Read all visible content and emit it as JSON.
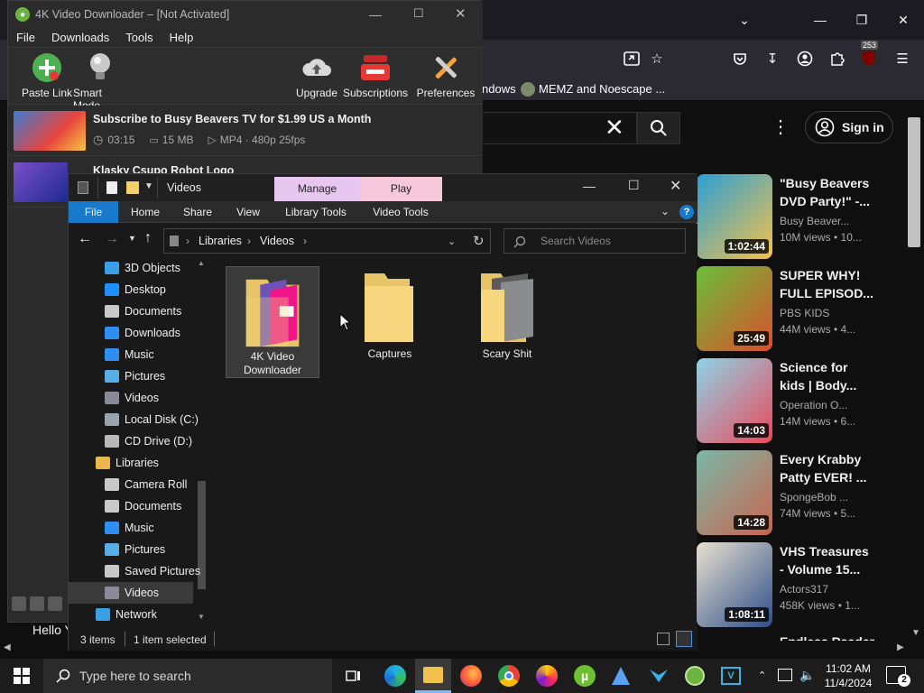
{
  "browser": {
    "bookmark_fragment": "ndows",
    "bookmark_memz": "MEMZ and Noescape ...",
    "notification_badge": "253",
    "sign_in_label": "Sign in",
    "partial_bottom_left": "Hello Y",
    "partial_bottom_title": "Endless Raader",
    "videos": [
      {
        "title_line1": "\"Busy Beavers",
        "title_line2": "DVD Party!\" -...",
        "channel": "Busy Beaver...",
        "views": "10M views  •  10...",
        "duration": "1:02:44",
        "colors": [
          "#2a9fd6",
          "#f5c24a"
        ]
      },
      {
        "title_line1": "SUPER WHY!",
        "title_line2": "FULL EPISOD...",
        "channel": "PBS KIDS",
        "views": "44M views  •  4...",
        "duration": "25:49",
        "colors": [
          "#6bbf3b",
          "#d94f2b"
        ]
      },
      {
        "title_line1": "Science for",
        "title_line2": "kids | Body...",
        "channel": "Operation O...",
        "views": "14M views  •  6...",
        "duration": "14:03",
        "colors": [
          "#8fd3e8",
          "#e84b5a"
        ]
      },
      {
        "title_line1": "Every Krabby",
        "title_line2": "Patty EVER! ...",
        "channel": "SpongeBob ...",
        "views": "74M views  •  5...",
        "duration": "14:28",
        "colors": [
          "#7ab8a8",
          "#c9654f"
        ]
      },
      {
        "title_line1": "VHS Treasures",
        "title_line2": "- Volume 15...",
        "channel": "Actors317",
        "views": "458K views  •  1...",
        "duration": "1:08:11",
        "colors": [
          "#e9e1cf",
          "#2d4d8a"
        ]
      }
    ]
  },
  "vdl": {
    "title": "4K Video Downloader – [Not Activated]",
    "menu": [
      "File",
      "Downloads",
      "Tools",
      "Help"
    ],
    "tools": {
      "paste_link": "Paste Link",
      "smart_mode": "Smart Mode",
      "upgrade": "Upgrade",
      "subscriptions": "Subscriptions",
      "preferences": "Preferences"
    },
    "items": [
      {
        "title": "Subscribe to Busy Beavers TV for $1.99 US a Month",
        "duration": "03:15",
        "size": "15 MB",
        "format": "MP4 · 480p 25fps"
      },
      {
        "title": "Klasky Csupo Robot Logo"
      }
    ]
  },
  "explorer": {
    "title": "Videos",
    "context_tabs": {
      "manage": "Manage",
      "play": "Play"
    },
    "ribbon_tabs": [
      "File",
      "Home",
      "Share",
      "View",
      "Library Tools",
      "Video Tools"
    ],
    "address": {
      "part1": "Libraries",
      "part2": "Videos"
    },
    "search_placeholder": "Search Videos",
    "nav": [
      {
        "label": "3D Objects",
        "color": "#3aa0e8",
        "indent": 1
      },
      {
        "label": "Desktop",
        "color": "#1e90ff",
        "indent": 1
      },
      {
        "label": "Documents",
        "color": "#c9c9c9",
        "indent": 1
      },
      {
        "label": "Downloads",
        "color": "#2f8ef0",
        "indent": 1
      },
      {
        "label": "Music",
        "color": "#2f8ef0",
        "indent": 1
      },
      {
        "label": "Pictures",
        "color": "#5aaee6",
        "indent": 1
      },
      {
        "label": "Videos",
        "color": "#8a8a9a",
        "indent": 1
      },
      {
        "label": "Local Disk (C:)",
        "color": "#9aa4ad",
        "indent": 1
      },
      {
        "label": "CD Drive (D:)",
        "color": "#b9b9b9",
        "indent": 1
      },
      {
        "label": "Libraries",
        "color": "#e8b84a",
        "indent": 0
      },
      {
        "label": "Camera Roll",
        "color": "#c8c8c8",
        "indent": 1
      },
      {
        "label": "Documents",
        "color": "#c9c9c9",
        "indent": 1
      },
      {
        "label": "Music",
        "color": "#2f8ef0",
        "indent": 1
      },
      {
        "label": "Pictures",
        "color": "#5aaee6",
        "indent": 1
      },
      {
        "label": "Saved Pictures",
        "color": "#c8c8c8",
        "indent": 1
      },
      {
        "label": "Videos",
        "color": "#8a8a9a",
        "indent": 1,
        "selected": true
      },
      {
        "label": "Network",
        "color": "#3aa0e8",
        "indent": 0
      }
    ],
    "folders": [
      {
        "line1": "4K Video",
        "line2": "Downloader",
        "selected": true
      },
      {
        "line1": "Captures",
        "line2": ""
      },
      {
        "line1": "Scary Shit",
        "line2": ""
      }
    ],
    "status": {
      "count": "3 items",
      "selected": "1 item selected"
    }
  },
  "taskbar": {
    "search_placeholder": "Type here to search",
    "time": "11:02 AM",
    "date": "11/4/2024",
    "notification_count": "2"
  }
}
